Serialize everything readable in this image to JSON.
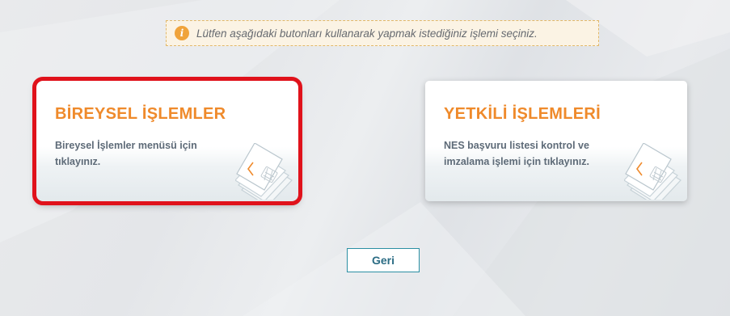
{
  "notice": {
    "icon": "info-icon",
    "icon_glyph": "i",
    "text": "Lütfen aşağıdaki butonları kullanarak yapmak istediğiniz işlemi seçiniz."
  },
  "cards": {
    "individual": {
      "title": "BİREYSEL İŞLEMLER",
      "description": "Bireysel İşlemler menüsü için tıklayınız.",
      "icon": "smart-card-icon",
      "highlighted": true,
      "highlight_color": "#e0121b"
    },
    "authorized": {
      "title": "YETKİLİ İŞLEMLERİ",
      "description": "NES başvuru listesi kontrol ve imzalama işlemi için tıklayınız.",
      "icon": "smart-card-icon"
    }
  },
  "back_button": {
    "label": "Geri"
  },
  "colors": {
    "accent_orange": "#ef8a2b",
    "text_muted": "#5e6b78",
    "button_border": "#2b8fa3",
    "notice_bg": "#fbf3e4",
    "notice_border": "#e2b869"
  }
}
